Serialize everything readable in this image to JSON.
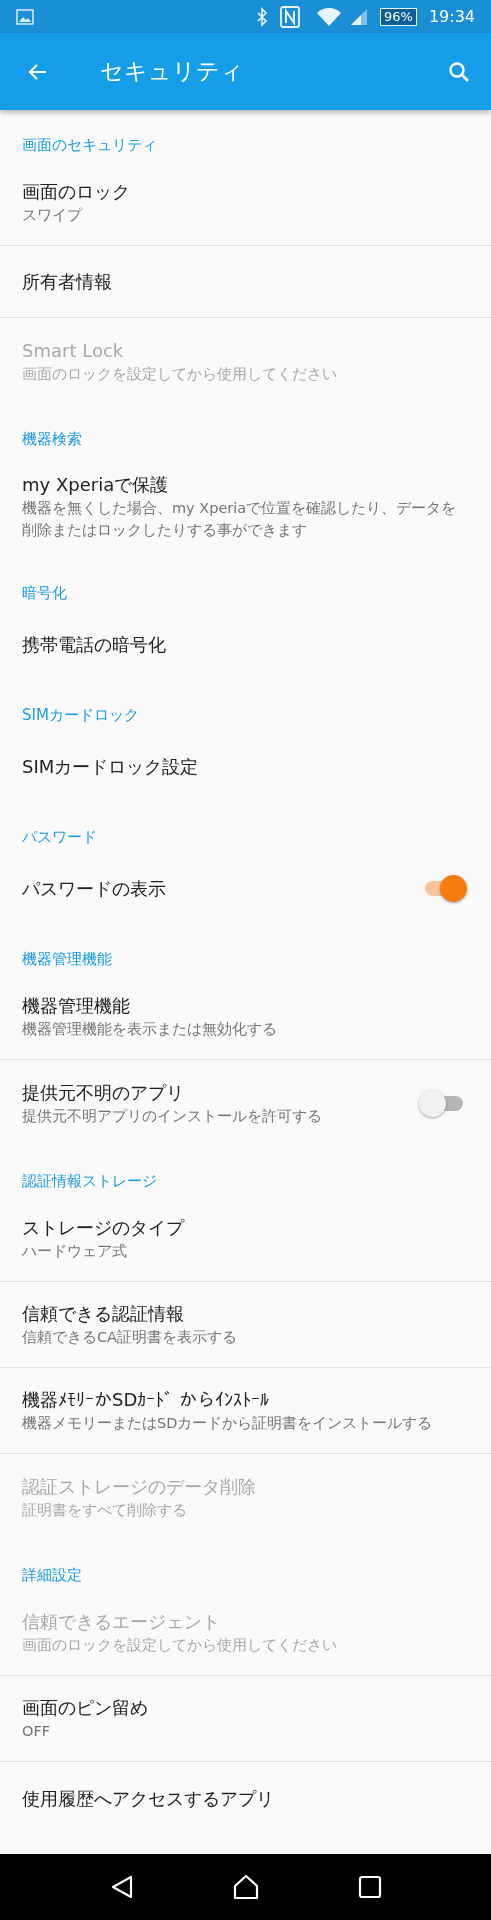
{
  "status_bar": {
    "battery": "96%",
    "time": "19:34"
  },
  "app_bar": {
    "title": "セキュリティ"
  },
  "sections": [
    {
      "header": "画面のセキュリティ",
      "items": [
        {
          "kind": "text",
          "title": "画面のロック",
          "subtitle": "スワイプ",
          "disabled": false
        },
        {
          "kind": "text",
          "title": "所有者情報",
          "disabled": false
        },
        {
          "kind": "text",
          "title": "Smart Lock",
          "subtitle": "画面のロックを設定してから使用してください",
          "disabled": true
        }
      ]
    },
    {
      "header": "機器検索",
      "items": [
        {
          "kind": "text",
          "title": "my Xperiaで保護",
          "subtitle": "機器を無くした場合、my Xperiaで位置を確認したり、データを削除またはロックしたりする事ができます",
          "disabled": false
        }
      ]
    },
    {
      "header": "暗号化",
      "items": [
        {
          "kind": "text",
          "title": "携帯電話の暗号化",
          "disabled": false
        }
      ]
    },
    {
      "header": "SIMカードロック",
      "items": [
        {
          "kind": "text",
          "title": "SIMカードロック設定",
          "disabled": false
        }
      ]
    },
    {
      "header": "パスワード",
      "items": [
        {
          "kind": "toggle",
          "title": "パスワードの表示",
          "disabled": false,
          "on": true
        }
      ]
    },
    {
      "header": "機器管理機能",
      "items": [
        {
          "kind": "text",
          "title": "機器管理機能",
          "subtitle": "機器管理機能を表示または無効化する",
          "disabled": false
        },
        {
          "kind": "toggle",
          "title": "提供元不明のアプリ",
          "subtitle": "提供元不明アプリのインストールを許可する",
          "disabled": false,
          "on": false
        }
      ]
    },
    {
      "header": "認証情報ストレージ",
      "items": [
        {
          "kind": "text",
          "title": "ストレージのタイプ",
          "subtitle": "ハードウェア式",
          "disabled": false
        },
        {
          "kind": "text",
          "title": "信頼できる認証情報",
          "subtitle": "信頼できるCA証明書を表示する",
          "disabled": false
        },
        {
          "kind": "text",
          "title": "機器ﾒﾓﾘｰかSDｶｰﾄﾞ からｲﾝｽﾄｰﾙ",
          "subtitle": "機器メモリーまたはSDカードから証明書をインストールする",
          "disabled": false
        },
        {
          "kind": "text",
          "title": "認証ストレージのデータ削除",
          "subtitle": "証明書をすべて削除する",
          "disabled": true
        }
      ]
    },
    {
      "header": "詳細設定",
      "items": [
        {
          "kind": "text",
          "title": "信頼できるエージェント",
          "subtitle": "画面のロックを設定してから使用してください",
          "disabled": true
        },
        {
          "kind": "text",
          "title": "画面のピン留め",
          "subtitle": "OFF",
          "disabled": false
        },
        {
          "kind": "text",
          "title": "使用履歴へアクセスするアプリ",
          "disabled": false
        }
      ]
    }
  ]
}
